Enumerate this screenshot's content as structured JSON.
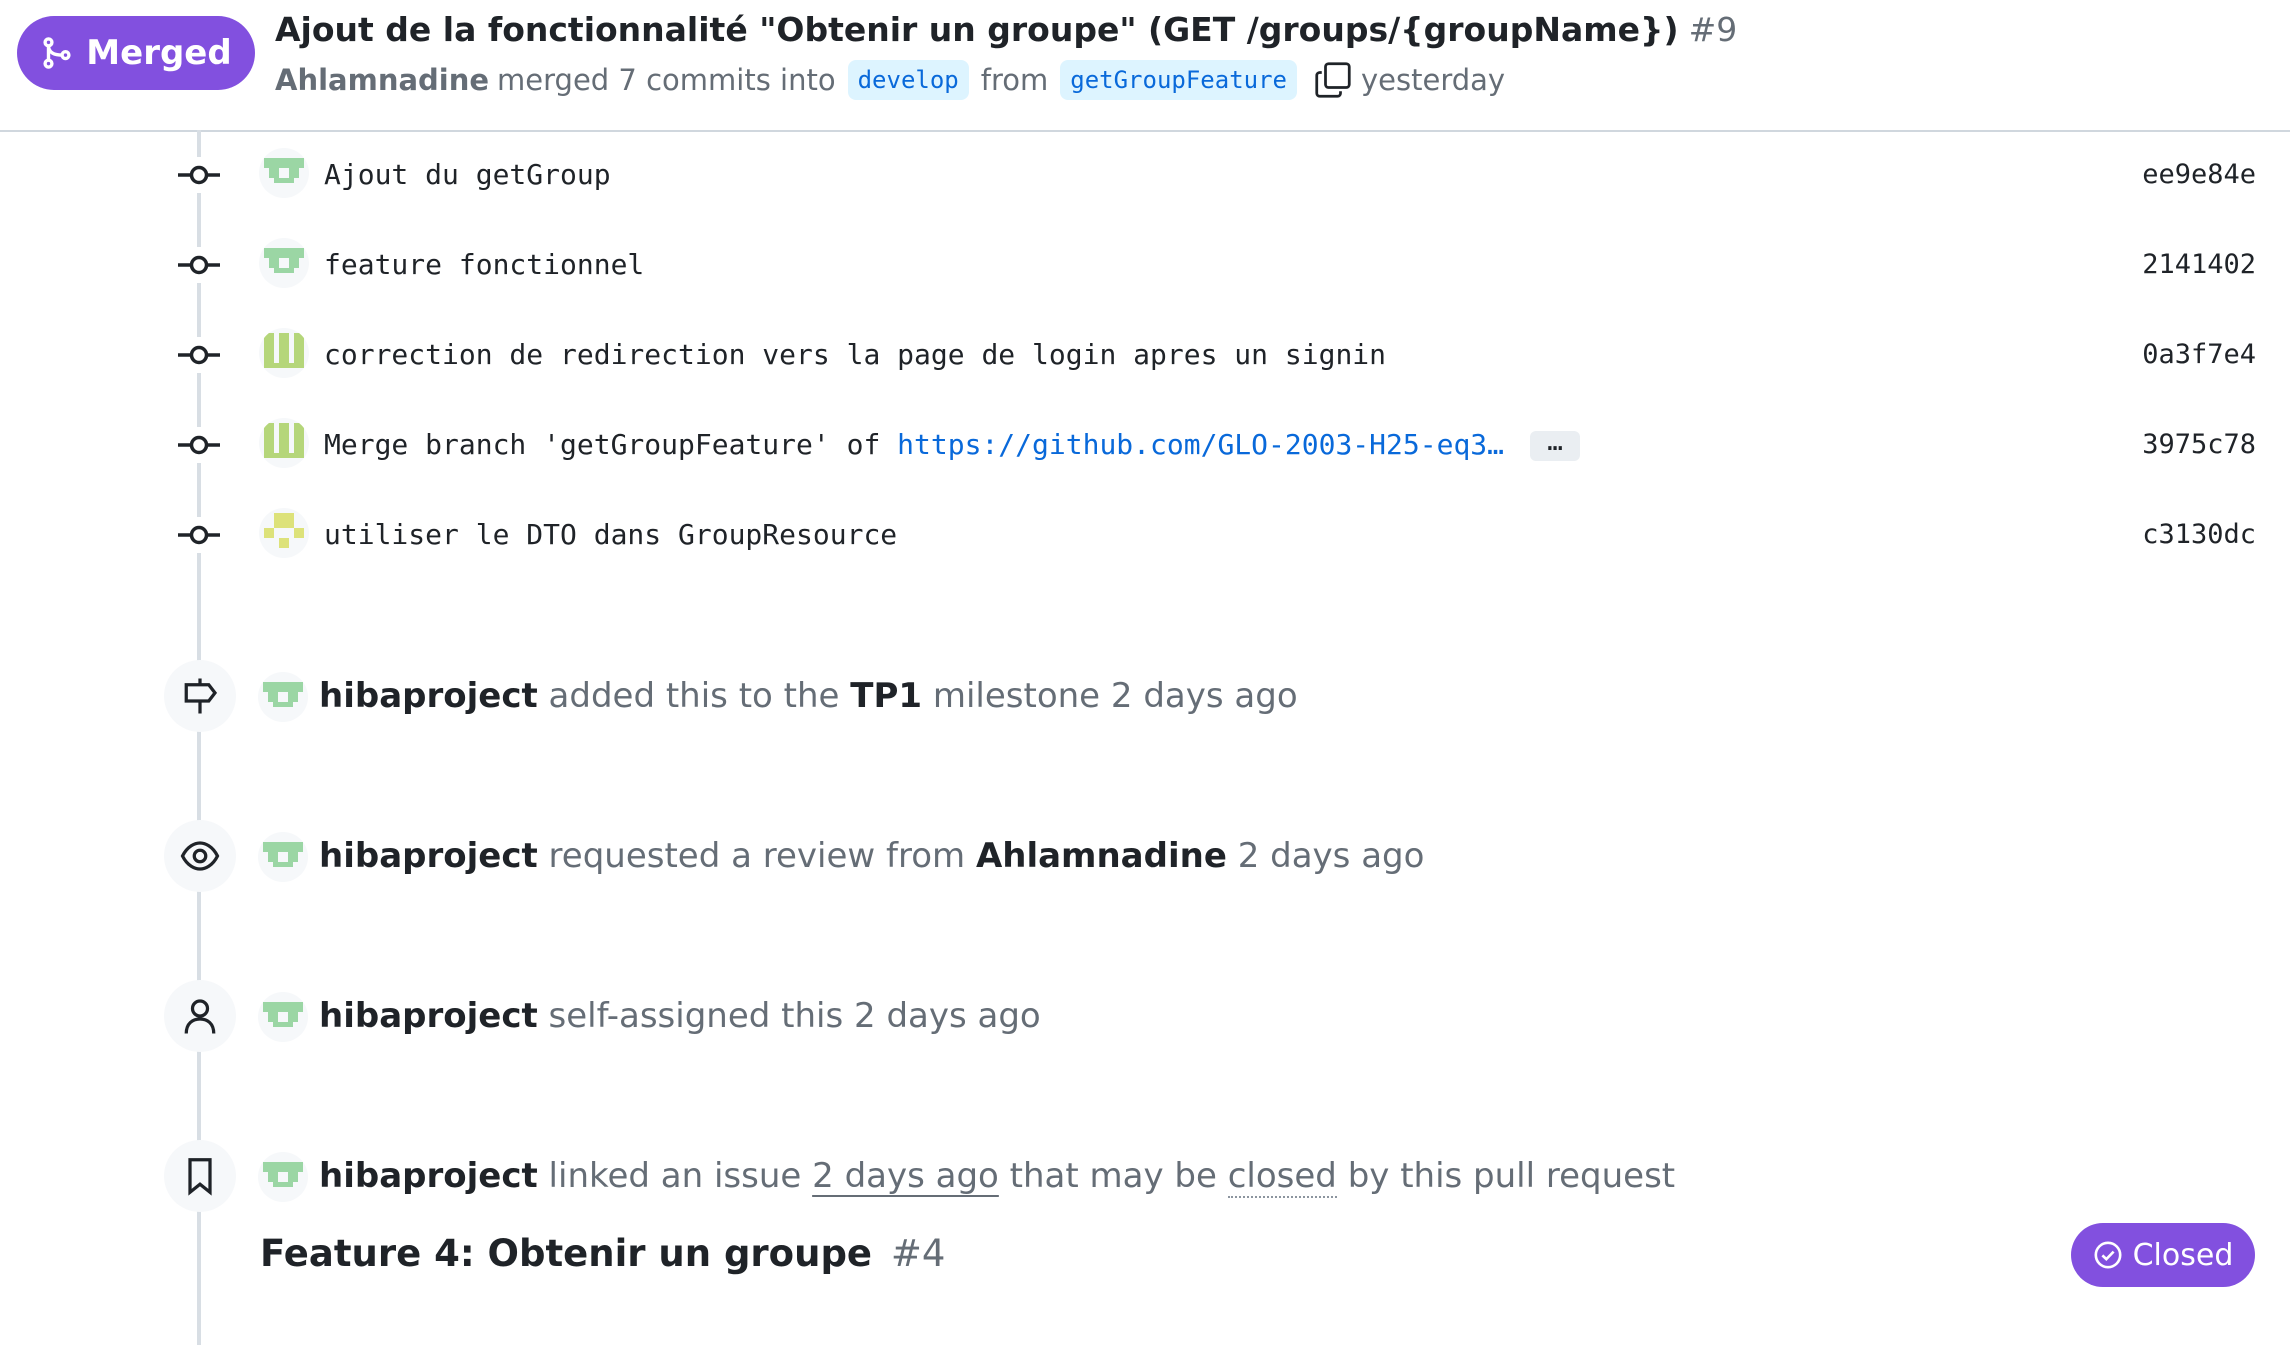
{
  "header": {
    "state_label": "Merged",
    "title": "Ajout de la fonctionnalité \"Obtenir un groupe\" (GET /groups/{groupName})",
    "number": "#9",
    "author": "Ahlamnadine",
    "merged_text": "merged 7 commits into",
    "base_branch": "develop",
    "from_text": "from",
    "head_branch": "getGroupFeature",
    "time": "yesterday"
  },
  "commits": [
    {
      "message": "Ajout du getGroup",
      "sha": "ee9e84e"
    },
    {
      "message": "feature fonctionnel",
      "sha": "2141402"
    },
    {
      "message": "correction de redirection vers la page de login apres un signin",
      "sha": "0a3f7e4"
    },
    {
      "message_prefix": "Merge branch 'getGroupFeature' of ",
      "message_link": "https://github.com/GLO-2003-H25-eq3…",
      "more_label": "…",
      "sha": "3975c78"
    },
    {
      "message": "utiliser le DTO dans GroupResource",
      "sha": "c3130dc"
    }
  ],
  "events": [
    {
      "actor": "hibaproject",
      "text_a": "added this to the",
      "target": "TP1",
      "text_b": "milestone 2 days ago"
    },
    {
      "actor": "hibaproject",
      "text_a": "requested a review from",
      "target": "Ahlamnadine",
      "text_b": "2 days ago"
    },
    {
      "actor": "hibaproject",
      "text_a": "self-assigned this 2 days ago"
    },
    {
      "actor": "hibaproject",
      "text_a": "linked an issue",
      "time_link": "2 days ago",
      "text_b": "that may be",
      "closed_word": "closed",
      "text_c": "by this pull request"
    }
  ],
  "linked_issue": {
    "title": "Feature 4: Obtenir un groupe",
    "number": "#4",
    "state": "Closed"
  },
  "colors": {
    "merged_purple": "#8250df",
    "link_blue": "#0969da",
    "branch_bg": "#ddf4ff",
    "muted_text": "#656d76"
  },
  "icons": [
    "git-merge-icon",
    "copy-icon",
    "git-commit-icon",
    "milestone-icon",
    "eye-icon",
    "person-icon",
    "bookmark-icon",
    "check-circle-icon"
  ]
}
